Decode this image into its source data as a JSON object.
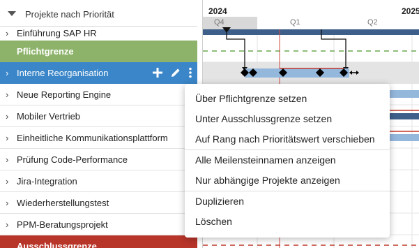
{
  "list": {
    "header_title": "Projekte nach Priorität",
    "rows": [
      {
        "label": "Einführung SAP HR",
        "style": "normal"
      },
      {
        "label": "Pflichtgrenze",
        "style": "green"
      },
      {
        "label": "Interne Reorganisation",
        "style": "blue"
      },
      {
        "label": "Neue Reporting Engine",
        "style": "normal"
      },
      {
        "label": "Mobiler Vertrieb",
        "style": "normal"
      },
      {
        "label": "Einheitliche Kommunikationsplattform",
        "style": "normal"
      },
      {
        "label": "Prüfung Code-Performance",
        "style": "normal"
      },
      {
        "label": "Jira-Integration",
        "style": "normal"
      },
      {
        "label": "Wiederherstellungstest",
        "style": "normal"
      },
      {
        "label": "PPM-Beratungsprojekt",
        "style": "normal"
      },
      {
        "label": "Ausschlussgrenze",
        "style": "red"
      }
    ]
  },
  "timeline": {
    "years": [
      "2024",
      "2025"
    ],
    "quarters": [
      "Q4",
      "Q1",
      "Q2"
    ]
  },
  "context_menu": {
    "items": [
      "Über Pflichtgrenze setzen",
      "Unter Ausschlussgrenze setzen",
      "Auf Rang nach Prioritätswert verschieben",
      "Alle Meilensteinnamen anzeigen",
      "Nur abhängige Projekte anzeigen",
      "Duplizieren",
      "Löschen"
    ]
  },
  "icons": {
    "row_expand": "chevron-right-icon",
    "header_collapse": "triangle-down-icon",
    "add": "plus-icon",
    "edit": "pencil-icon",
    "more": "more-vertical-icon",
    "milestone": "diamond-icon"
  },
  "colors": {
    "green_row": "#8db36a",
    "blue_row": "#3a86c8",
    "red_row": "#b8352a",
    "bar_blue": "#94b7dc",
    "bar_navy": "#3e5f8a",
    "today_line": "#d24a43",
    "green_dash": "#6aa84f",
    "red_dash": "#c0392b"
  }
}
